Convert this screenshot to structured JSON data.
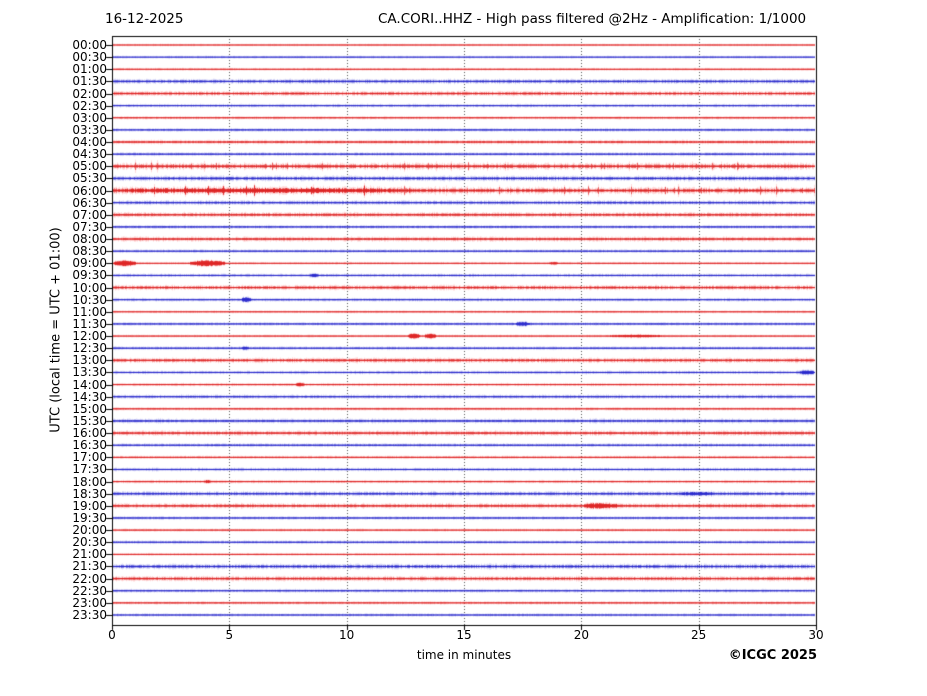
{
  "header": {
    "date": "16-12-2025",
    "title": "CA.CORI..HHZ - High pass filtered @2Hz - Amplification: 1/1000"
  },
  "footer": {
    "copyright": "©ICGC 2025"
  },
  "axes": {
    "x_label": "time in minutes",
    "y_label": "UTC (local time = UTC + 01:00)",
    "x_ticks": [
      0,
      5,
      10,
      15,
      20,
      25,
      30
    ],
    "x_range": [
      0,
      30
    ],
    "grid_x": [
      5,
      10,
      15,
      20,
      25
    ],
    "grid_style": "dotted-vertical"
  },
  "colors": {
    "hour_trace": "#dd2222",
    "hour_fuzz": "#ff9999",
    "half_hour_trace": "#2828cc",
    "half_hour_fuzz": "#9a9ae8",
    "grid": "#555555",
    "frame": "#000000",
    "text": "#000000"
  },
  "chart_data": {
    "type": "line",
    "subtype": "helicorder-seismogram",
    "station": "CA.CORI..HHZ",
    "filter": "High pass filtered @2Hz",
    "amplification": "1/1000",
    "date": "16-12-2025",
    "minutes_per_row": 30,
    "row_color_rule": "red = on the hour, blue = on the half hour",
    "rows": [
      {
        "time": "00:00",
        "color": "red",
        "noise": 0.5,
        "events": []
      },
      {
        "time": "00:30",
        "color": "blue",
        "noise": 0.6,
        "events": []
      },
      {
        "time": "01:00",
        "color": "red",
        "noise": 0.6,
        "events": []
      },
      {
        "time": "01:30",
        "color": "blue",
        "noise": 1.4,
        "events": []
      },
      {
        "time": "02:00",
        "color": "red",
        "noise": 1.4,
        "events": []
      },
      {
        "time": "02:30",
        "color": "blue",
        "noise": 0.9,
        "events": []
      },
      {
        "time": "03:00",
        "color": "red",
        "noise": 0.8,
        "events": []
      },
      {
        "time": "03:30",
        "color": "blue",
        "noise": 0.9,
        "events": []
      },
      {
        "time": "04:00",
        "color": "red",
        "noise": 1.2,
        "events": []
      },
      {
        "time": "04:30",
        "color": "blue",
        "noise": 1.0,
        "events": []
      },
      {
        "time": "05:00",
        "color": "red",
        "noise": 2.0,
        "events": []
      },
      {
        "time": "05:30",
        "color": "blue",
        "noise": 1.6,
        "events": []
      },
      {
        "time": "06:00",
        "color": "red",
        "noise": 2.1,
        "events": [
          {
            "start": 0,
            "end": 13,
            "amp": 0.8
          }
        ]
      },
      {
        "time": "06:30",
        "color": "blue",
        "noise": 1.3,
        "events": []
      },
      {
        "time": "07:00",
        "color": "red",
        "noise": 1.5,
        "events": []
      },
      {
        "time": "07:30",
        "color": "blue",
        "noise": 1.0,
        "events": []
      },
      {
        "time": "08:00",
        "color": "red",
        "noise": 1.4,
        "events": []
      },
      {
        "time": "08:30",
        "color": "blue",
        "noise": 0.9,
        "events": []
      },
      {
        "time": "09:00",
        "color": "red",
        "noise": 0.6,
        "events": [
          {
            "start": 0.05,
            "end": 1.0,
            "amp": 2.6
          },
          {
            "start": 3.3,
            "end": 4.8,
            "amp": 2.6
          },
          {
            "start": 18.6,
            "end": 19.0,
            "amp": 1.0
          }
        ]
      },
      {
        "time": "09:30",
        "color": "blue",
        "noise": 0.9,
        "events": [
          {
            "start": 8.4,
            "end": 8.8,
            "amp": 1.2
          }
        ]
      },
      {
        "time": "10:00",
        "color": "red",
        "noise": 1.5,
        "events": []
      },
      {
        "time": "10:30",
        "color": "blue",
        "noise": 0.9,
        "events": [
          {
            "start": 5.5,
            "end": 5.9,
            "amp": 1.8
          }
        ]
      },
      {
        "time": "11:00",
        "color": "red",
        "noise": 0.6,
        "events": []
      },
      {
        "time": "11:30",
        "color": "blue",
        "noise": 0.9,
        "events": [
          {
            "start": 17.2,
            "end": 17.8,
            "amp": 1.4
          }
        ]
      },
      {
        "time": "12:00",
        "color": "red",
        "noise": 0.6,
        "events": [
          {
            "start": 12.6,
            "end": 13.1,
            "amp": 2.3
          },
          {
            "start": 13.3,
            "end": 13.8,
            "amp": 2.3
          },
          {
            "start": 21.2,
            "end": 23.4,
            "amp": 0.9
          }
        ]
      },
      {
        "time": "12:30",
        "color": "blue",
        "noise": 0.9,
        "events": [
          {
            "start": 5.5,
            "end": 5.8,
            "amp": 1.0
          }
        ]
      },
      {
        "time": "13:00",
        "color": "red",
        "noise": 1.5,
        "events": []
      },
      {
        "time": "13:30",
        "color": "blue",
        "noise": 0.9,
        "events": [
          {
            "start": 29.3,
            "end": 29.9,
            "amp": 1.6
          }
        ]
      },
      {
        "time": "14:00",
        "color": "red",
        "noise": 0.8,
        "events": [
          {
            "start": 7.8,
            "end": 8.2,
            "amp": 1.4
          }
        ]
      },
      {
        "time": "14:30",
        "color": "blue",
        "noise": 1.1,
        "events": []
      },
      {
        "time": "15:00",
        "color": "red",
        "noise": 0.8,
        "events": []
      },
      {
        "time": "15:30",
        "color": "blue",
        "noise": 1.3,
        "events": []
      },
      {
        "time": "16:00",
        "color": "red",
        "noise": 1.5,
        "events": []
      },
      {
        "time": "16:30",
        "color": "blue",
        "noise": 1.0,
        "events": []
      },
      {
        "time": "17:00",
        "color": "red",
        "noise": 0.8,
        "events": []
      },
      {
        "time": "17:30",
        "color": "blue",
        "noise": 0.9,
        "events": []
      },
      {
        "time": "18:00",
        "color": "red",
        "noise": 0.8,
        "events": [
          {
            "start": 3.9,
            "end": 4.2,
            "amp": 1.0
          }
        ]
      },
      {
        "time": "18:30",
        "color": "blue",
        "noise": 1.4,
        "events": [
          {
            "start": 24.2,
            "end": 25.6,
            "amp": 0.7
          }
        ]
      },
      {
        "time": "19:00",
        "color": "red",
        "noise": 1.5,
        "events": [
          {
            "start": 20.1,
            "end": 21.5,
            "amp": 1.7
          }
        ]
      },
      {
        "time": "19:30",
        "color": "blue",
        "noise": 0.9,
        "events": []
      },
      {
        "time": "20:00",
        "color": "red",
        "noise": 0.7,
        "events": []
      },
      {
        "time": "20:30",
        "color": "blue",
        "noise": 0.9,
        "events": []
      },
      {
        "time": "21:00",
        "color": "red",
        "noise": 0.6,
        "events": []
      },
      {
        "time": "21:30",
        "color": "blue",
        "noise": 1.6,
        "events": []
      },
      {
        "time": "22:00",
        "color": "red",
        "noise": 1.5,
        "events": []
      },
      {
        "time": "22:30",
        "color": "blue",
        "noise": 0.9,
        "events": []
      },
      {
        "time": "23:00",
        "color": "red",
        "noise": 0.8,
        "events": []
      },
      {
        "time": "23:30",
        "color": "blue",
        "noise": 0.8,
        "events": []
      }
    ]
  }
}
